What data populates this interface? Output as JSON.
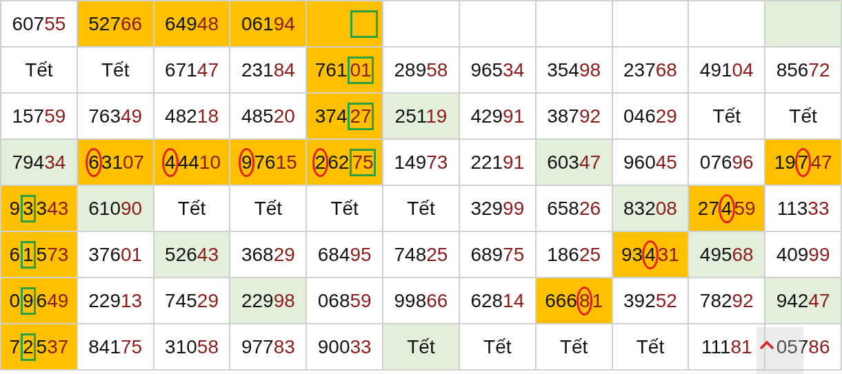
{
  "rows": [
    {
      "cells": [
        {
          "color": "#ffffff",
          "parts": [
            {
              "text": "607",
              "red": false
            },
            {
              "text": "55",
              "red": true
            }
          ]
        },
        {
          "color": "#ffc000",
          "parts": [
            {
              "text": "527",
              "red": false
            },
            {
              "text": "66",
              "red": true
            }
          ]
        },
        {
          "color": "#ffc000",
          "parts": [
            {
              "text": "649",
              "red": false
            },
            {
              "text": "48",
              "red": true
            }
          ]
        },
        {
          "color": "#ffc000",
          "parts": [
            {
              "text": "061",
              "red": false
            },
            {
              "text": "94",
              "red": true
            }
          ]
        },
        {
          "color": "#ffc000",
          "boxed": true
        },
        {
          "color": "#ffffff"
        },
        {
          "color": "#ffffff"
        },
        {
          "color": "#ffffff"
        },
        {
          "color": "#ffffff"
        },
        {
          "color": "#ffffff"
        },
        {
          "color": "#e2efda"
        }
      ]
    },
    {
      "cells": [
        {
          "color": "#ffffff",
          "parts": [
            {
              "text": "Tết",
              "red": false
            }
          ]
        },
        {
          "color": "#ffffff",
          "parts": [
            {
              "text": "Tết",
              "red": false
            }
          ]
        },
        {
          "color": "#ffffff",
          "parts": [
            {
              "text": "671",
              "red": false
            },
            {
              "text": "47",
              "red": true
            }
          ]
        },
        {
          "color": "#ffffff",
          "parts": [
            {
              "text": "231",
              "red": false
            },
            {
              "text": "84",
              "red": true
            }
          ]
        },
        {
          "color": "#ffc000",
          "parts": [
            {
              "text": "761",
              "red": false,
              "circled": false,
              "boxed": false
            },
            {
              "text": "01",
              "red": true,
              "circled": false,
              "boxed": true
            }
          ]
        },
        {
          "color": "#ffffff",
          "parts": [
            {
              "text": "289",
              "red": false
            },
            {
              "text": "58",
              "red": true
            }
          ]
        },
        {
          "color": "#ffffff",
          "parts": [
            {
              "text": "965",
              "red": false
            },
            {
              "text": "34",
              "red": true
            }
          ]
        },
        {
          "color": "#ffffff",
          "parts": [
            {
              "text": "354",
              "red": false
            },
            {
              "text": "98",
              "red": true
            }
          ]
        },
        {
          "color": "#ffffff",
          "parts": [
            {
              "text": "237",
              "red": false
            },
            {
              "text": "68",
              "red": true
            }
          ]
        },
        {
          "color": "#ffffff",
          "parts": [
            {
              "text": "491",
              "red": false
            },
            {
              "text": "04",
              "red": true
            }
          ]
        },
        {
          "color": "#ffffff",
          "parts": [
            {
              "text": "856",
              "red": false
            },
            {
              "text": "72",
              "red": true
            }
          ]
        }
      ]
    },
    {
      "cells": [
        {
          "color": "#ffffff",
          "parts": [
            {
              "text": "157",
              "red": false
            },
            {
              "text": "59",
              "red": true
            }
          ]
        },
        {
          "color": "#ffffff",
          "parts": [
            {
              "text": "763",
              "red": false
            },
            {
              "text": "49",
              "red": true
            }
          ]
        },
        {
          "color": "#ffffff",
          "parts": [
            {
              "text": "482",
              "red": false
            },
            {
              "text": "18",
              "red": true
            }
          ]
        },
        {
          "color": "#ffffff",
          "parts": [
            {
              "text": "485",
              "red": false
            },
            {
              "text": "20",
              "red": true
            }
          ]
        },
        {
          "color": "#ffc000",
          "parts": [
            {
              "text": "374",
              "red": false,
              "circled": false,
              "boxed": false
            },
            {
              "text": "27",
              "red": true,
              "circled": false,
              "boxed": true
            }
          ]
        },
        {
          "color": "#e2efda",
          "parts": [
            {
              "text": "251",
              "red": false
            },
            {
              "text": "19",
              "red": true
            }
          ]
        },
        {
          "color": "#ffffff",
          "parts": [
            {
              "text": "429",
              "red": false
            },
            {
              "text": "91",
              "red": true
            }
          ]
        },
        {
          "color": "#ffffff",
          "parts": [
            {
              "text": "387",
              "red": false
            },
            {
              "text": "92",
              "red": true
            }
          ]
        },
        {
          "color": "#ffffff",
          "parts": [
            {
              "text": "046",
              "red": false
            },
            {
              "text": "29",
              "red": true
            }
          ]
        },
        {
          "color": "#ffffff",
          "parts": [
            {
              "text": "Tết",
              "red": false
            }
          ]
        },
        {
          "color": "#ffffff",
          "parts": [
            {
              "text": "Tết",
              "red": false
            }
          ]
        }
      ]
    },
    {
      "cells": [
        {
          "color": "#e2efda",
          "parts": [
            {
              "text": "794",
              "red": false
            },
            {
              "text": "34",
              "red": true
            }
          ]
        },
        {
          "color": "#ffc000",
          "parts": [
            {
              "text": "6",
              "red": false,
              "circled": true,
              "boxed": false
            },
            {
              "text": "31",
              "red": false,
              "circled": false,
              "boxed": false
            },
            {
              "text": "07",
              "red": true,
              "circled": false,
              "boxed": false
            }
          ]
        },
        {
          "color": "#ffc000",
          "parts": [
            {
              "text": "4",
              "red": false,
              "circled": true,
              "boxed": false
            },
            {
              "text": "44",
              "red": false,
              "circled": false,
              "boxed": false
            },
            {
              "text": "10",
              "red": true,
              "circled": false,
              "boxed": false
            }
          ]
        },
        {
          "color": "#ffc000",
          "parts": [
            {
              "text": "9",
              "red": false,
              "circled": true,
              "boxed": false
            },
            {
              "text": "76",
              "red": false,
              "circled": false,
              "boxed": false
            },
            {
              "text": "15",
              "red": true,
              "circled": false,
              "boxed": false
            }
          ]
        },
        {
          "color": "#ffc000",
          "parts": [
            {
              "text": "2",
              "red": false,
              "circled": true,
              "boxed": false
            },
            {
              "text": "62",
              "red": false,
              "circled": false,
              "boxed": false
            },
            {
              "text": "75",
              "red": true,
              "circled": false,
              "boxed": true
            }
          ]
        },
        {
          "color": "#ffffff",
          "parts": [
            {
              "text": "149",
              "red": false
            },
            {
              "text": "73",
              "red": true
            }
          ]
        },
        {
          "color": "#ffffff",
          "parts": [
            {
              "text": "221",
              "red": false
            },
            {
              "text": "91",
              "red": true
            }
          ]
        },
        {
          "color": "#e2efda",
          "parts": [
            {
              "text": "603",
              "red": false
            },
            {
              "text": "47",
              "red": true
            }
          ]
        },
        {
          "color": "#ffffff",
          "parts": [
            {
              "text": "960",
              "red": false
            },
            {
              "text": "45",
              "red": true
            }
          ]
        },
        {
          "color": "#ffffff",
          "parts": [
            {
              "text": "076",
              "red": false
            },
            {
              "text": "96",
              "red": true
            }
          ]
        },
        {
          "color": "#ffc000",
          "parts": [
            {
              "text": "19",
              "red": false,
              "circled": false,
              "boxed": false
            },
            {
              "text": "7",
              "red": false,
              "circled": true,
              "boxed": false
            },
            {
              "text": "47",
              "red": true,
              "circled": false,
              "boxed": false
            }
          ]
        }
      ]
    },
    {
      "cells": [
        {
          "color": "#ffc000",
          "parts": [
            {
              "text": "9",
              "red": false,
              "circled": false,
              "boxed": false
            },
            {
              "text": "3",
              "red": false,
              "circled": false,
              "boxed": true
            },
            {
              "text": "3",
              "red": false,
              "circled": false,
              "boxed": false
            },
            {
              "text": "43",
              "red": true,
              "circled": false,
              "boxed": false
            }
          ]
        },
        {
          "color": "#e2efda",
          "parts": [
            {
              "text": "610",
              "red": false
            },
            {
              "text": "90",
              "red": true
            }
          ]
        },
        {
          "color": "#ffffff",
          "parts": [
            {
              "text": "Tết",
              "red": false
            }
          ]
        },
        {
          "color": "#ffffff",
          "parts": [
            {
              "text": "Tết",
              "red": false
            }
          ]
        },
        {
          "color": "#ffffff",
          "parts": [
            {
              "text": "Tết",
              "red": false
            }
          ]
        },
        {
          "color": "#ffffff",
          "parts": [
            {
              "text": "Tết",
              "red": false
            }
          ]
        },
        {
          "color": "#ffffff",
          "parts": [
            {
              "text": "329",
              "red": false
            },
            {
              "text": "99",
              "red": true
            }
          ]
        },
        {
          "color": "#ffffff",
          "parts": [
            {
              "text": "658",
              "red": false
            },
            {
              "text": "26",
              "red": true
            }
          ]
        },
        {
          "color": "#e2efda",
          "parts": [
            {
              "text": "832",
              "red": false
            },
            {
              "text": "08",
              "red": true
            }
          ]
        },
        {
          "color": "#ffc000",
          "parts": [
            {
              "text": "27",
              "red": false,
              "circled": false,
              "boxed": false
            },
            {
              "text": "4",
              "red": false,
              "circled": true,
              "boxed": false
            },
            {
              "text": "59",
              "red": true,
              "circled": false,
              "boxed": false
            }
          ]
        },
        {
          "color": "#ffffff",
          "parts": [
            {
              "text": "113",
              "red": false
            },
            {
              "text": "33",
              "red": true
            }
          ]
        }
      ]
    },
    {
      "cells": [
        {
          "color": "#ffc000",
          "parts": [
            {
              "text": "6",
              "red": false,
              "circled": false,
              "boxed": false
            },
            {
              "text": "1",
              "red": false,
              "circled": false,
              "boxed": true
            },
            {
              "text": "5",
              "red": false,
              "circled": false,
              "boxed": false
            },
            {
              "text": "73",
              "red": true,
              "circled": false,
              "boxed": false
            }
          ]
        },
        {
          "color": "#ffffff",
          "parts": [
            {
              "text": "376",
              "red": false
            },
            {
              "text": "01",
              "red": true
            }
          ]
        },
        {
          "color": "#e2efda",
          "parts": [
            {
              "text": "526",
              "red": false
            },
            {
              "text": "43",
              "red": true
            }
          ]
        },
        {
          "color": "#ffffff",
          "parts": [
            {
              "text": "368",
              "red": false
            },
            {
              "text": "29",
              "red": true
            }
          ]
        },
        {
          "color": "#ffffff",
          "parts": [
            {
              "text": "684",
              "red": false
            },
            {
              "text": "95",
              "red": true
            }
          ]
        },
        {
          "color": "#ffffff",
          "parts": [
            {
              "text": "748",
              "red": false
            },
            {
              "text": "25",
              "red": true
            }
          ]
        },
        {
          "color": "#ffffff",
          "parts": [
            {
              "text": "689",
              "red": false
            },
            {
              "text": "75",
              "red": true
            }
          ]
        },
        {
          "color": "#ffffff",
          "parts": [
            {
              "text": "186",
              "red": false
            },
            {
              "text": "25",
              "red": true
            }
          ]
        },
        {
          "color": "#ffc000",
          "parts": [
            {
              "text": "93",
              "red": false,
              "circled": false,
              "boxed": false
            },
            {
              "text": "4",
              "red": false,
              "circled": true,
              "boxed": false
            },
            {
              "text": "31",
              "red": true,
              "circled": false,
              "boxed": false
            }
          ]
        },
        {
          "color": "#e2efda",
          "parts": [
            {
              "text": "495",
              "red": false
            },
            {
              "text": "68",
              "red": true
            }
          ]
        },
        {
          "color": "#ffffff",
          "parts": [
            {
              "text": "409",
              "red": false
            },
            {
              "text": "99",
              "red": true
            }
          ]
        }
      ]
    },
    {
      "cells": [
        {
          "color": "#ffc000",
          "parts": [
            {
              "text": "0",
              "red": false,
              "circled": false,
              "boxed": false
            },
            {
              "text": "9",
              "red": false,
              "circled": false,
              "boxed": true
            },
            {
              "text": "6",
              "red": false,
              "circled": false,
              "boxed": false
            },
            {
              "text": "49",
              "red": true,
              "circled": false,
              "boxed": false
            }
          ]
        },
        {
          "color": "#ffffff",
          "parts": [
            {
              "text": "229",
              "red": false
            },
            {
              "text": "13",
              "red": true
            }
          ]
        },
        {
          "color": "#ffffff",
          "parts": [
            {
              "text": "745",
              "red": false
            },
            {
              "text": "29",
              "red": true
            }
          ]
        },
        {
          "color": "#e2efda",
          "parts": [
            {
              "text": "229",
              "red": false
            },
            {
              "text": "98",
              "red": true
            }
          ]
        },
        {
          "color": "#ffffff",
          "parts": [
            {
              "text": "068",
              "red": false
            },
            {
              "text": "59",
              "red": true
            }
          ]
        },
        {
          "color": "#ffffff",
          "parts": [
            {
              "text": "998",
              "red": false
            },
            {
              "text": "66",
              "red": true
            }
          ]
        },
        {
          "color": "#ffffff",
          "parts": [
            {
              "text": "628",
              "red": false
            },
            {
              "text": "14",
              "red": true
            }
          ]
        },
        {
          "color": "#ffc000",
          "parts": [
            {
              "text": "666",
              "red": false,
              "circled": false,
              "boxed": false
            },
            {
              "text": "8",
              "red": true,
              "circled": true,
              "boxed": false
            },
            {
              "text": "1",
              "red": true,
              "circled": false,
              "boxed": false
            }
          ]
        },
        {
          "color": "#ffffff",
          "parts": [
            {
              "text": "392",
              "red": false
            },
            {
              "text": "52",
              "red": true
            }
          ]
        },
        {
          "color": "#ffffff",
          "parts": [
            {
              "text": "782",
              "red": false
            },
            {
              "text": "92",
              "red": true
            }
          ]
        },
        {
          "color": "#e2efda",
          "parts": [
            {
              "text": "942",
              "red": false
            },
            {
              "text": "47",
              "red": true
            }
          ]
        }
      ]
    },
    {
      "cells": [
        {
          "color": "#ffc000",
          "parts": [
            {
              "text": "7",
              "red": false,
              "circled": false,
              "boxed": false
            },
            {
              "text": "2",
              "red": false,
              "circled": false,
              "boxed": true
            },
            {
              "text": "5",
              "red": false,
              "circled": false,
              "boxed": false
            },
            {
              "text": "37",
              "red": true,
              "circled": false,
              "boxed": false
            }
          ]
        },
        {
          "color": "#ffffff",
          "parts": [
            {
              "text": "841",
              "red": false
            },
            {
              "text": "75",
              "red": true
            }
          ]
        },
        {
          "color": "#ffffff",
          "parts": [
            {
              "text": "310",
              "red": false
            },
            {
              "text": "58",
              "red": true
            }
          ]
        },
        {
          "color": "#ffffff",
          "parts": [
            {
              "text": "977",
              "red": false
            },
            {
              "text": "83",
              "red": true
            }
          ]
        },
        {
          "color": "#ffffff",
          "parts": [
            {
              "text": "900",
              "red": false
            },
            {
              "text": "33",
              "red": true
            }
          ]
        },
        {
          "color": "#e2efda",
          "parts": [
            {
              "text": "Tết",
              "red": false
            }
          ]
        },
        {
          "color": "#ffffff",
          "parts": [
            {
              "text": "Tết",
              "red": false
            }
          ]
        },
        {
          "color": "#ffffff",
          "parts": [
            {
              "text": "Tết",
              "red": false
            }
          ]
        },
        {
          "color": "#ffffff",
          "parts": [
            {
              "text": "Tết",
              "red": false
            }
          ]
        },
        {
          "color": "#ffffff",
          "parts": [
            {
              "text": "111",
              "red": false
            },
            {
              "text": "81",
              "red": true
            }
          ]
        },
        {
          "color": "#ffffff",
          "parts": [
            {
              "text": "057",
              "red": false
            },
            {
              "text": "86",
              "red": true
            }
          ]
        }
      ]
    }
  ]
}
